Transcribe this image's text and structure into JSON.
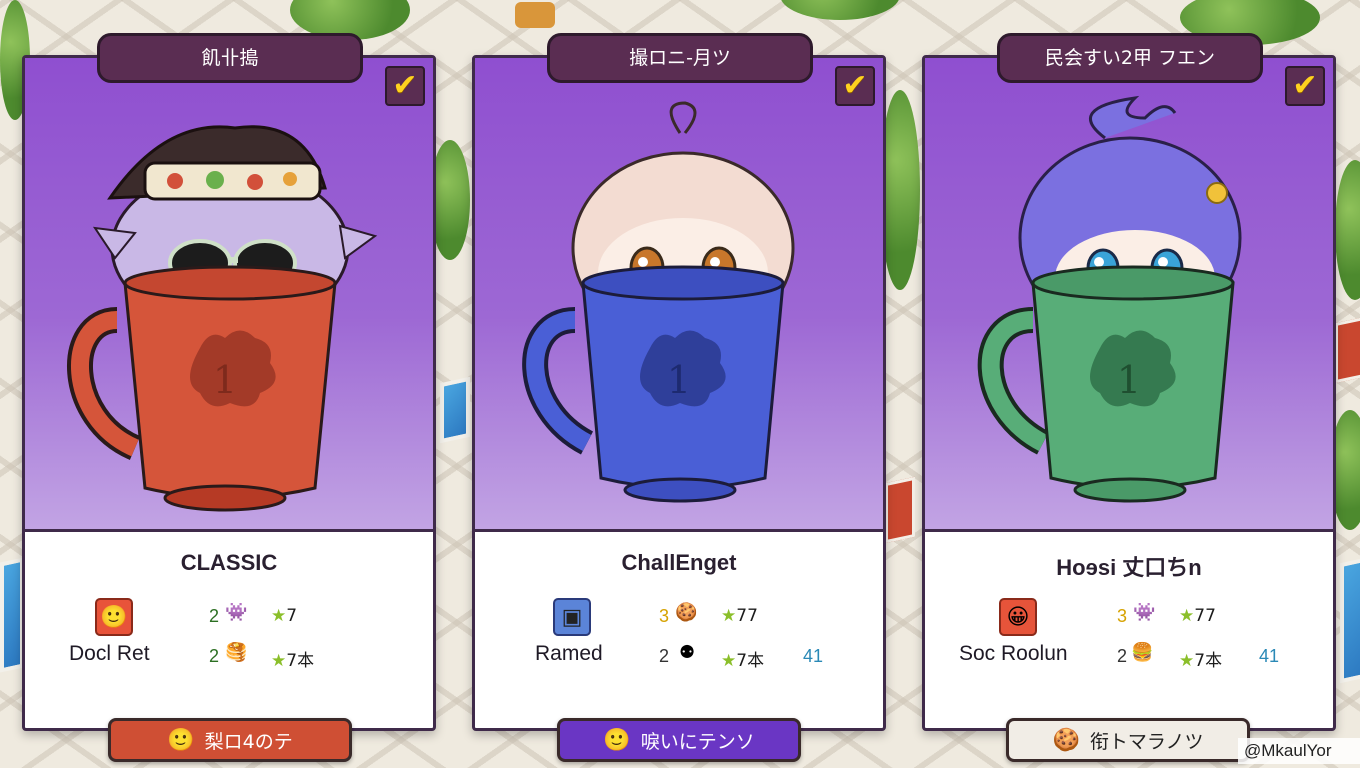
{
  "cards": [
    {
      "title": "飢卝搗",
      "checked": true,
      "mode": "CLASSIC",
      "cup_color": "#d5553a",
      "hair_color": "#c9b8e6",
      "player": {
        "name": "Docl Ret",
        "icon": "smiley-face-icon",
        "icon_color": "#e8533a"
      },
      "stats_row1": {
        "count": "2",
        "item_icon": "blue-creature-icon",
        "star": "7"
      },
      "stats_row2": {
        "count": "2",
        "item_icon": "pancake-icon",
        "star": "7本"
      },
      "button": {
        "label": "梨ロ4のテ",
        "bg": "#cf4f34",
        "fg": "#ffffff"
      }
    },
    {
      "title": "撮ロニ-月ツ",
      "checked": true,
      "mode": "ChallEnget",
      "cup_color": "#4a5fd6",
      "hair_color": "#f3dcd2",
      "player": {
        "name": "Ramed",
        "icon": "arcade-machine-icon",
        "icon_color": "#5b84d8"
      },
      "stats_row1": {
        "count": "3",
        "item_icon": "cookie-icon",
        "star": "77"
      },
      "stats_row2": {
        "count": "2",
        "item_icon": "dice-icon",
        "star": "7本",
        "extra": "41"
      },
      "button": {
        "label": "唳いにテンソ",
        "bg": "#6a36c4",
        "fg": "#ffffff"
      }
    },
    {
      "title": "民会すい2甲 フエン",
      "checked": true,
      "mode": "Hoɘsi 丈口ちn",
      "cup_color": "#58ad78",
      "hair_color": "#7b70e0",
      "player": {
        "name": "Soc Roolun",
        "icon": "grinning-face-icon",
        "icon_color": "#e6543a"
      },
      "stats_row1": {
        "count": "3",
        "item_icon": "blue-creature-icon",
        "star": "77"
      },
      "stats_row2": {
        "count": "2",
        "item_icon": "burger-icon",
        "star": "7本",
        "extra": "41"
      },
      "button": {
        "label": "衔トマラノツ",
        "bg": "#f1ede6",
        "fg": "#222222"
      }
    }
  ],
  "watermark": "@MkaulYor"
}
